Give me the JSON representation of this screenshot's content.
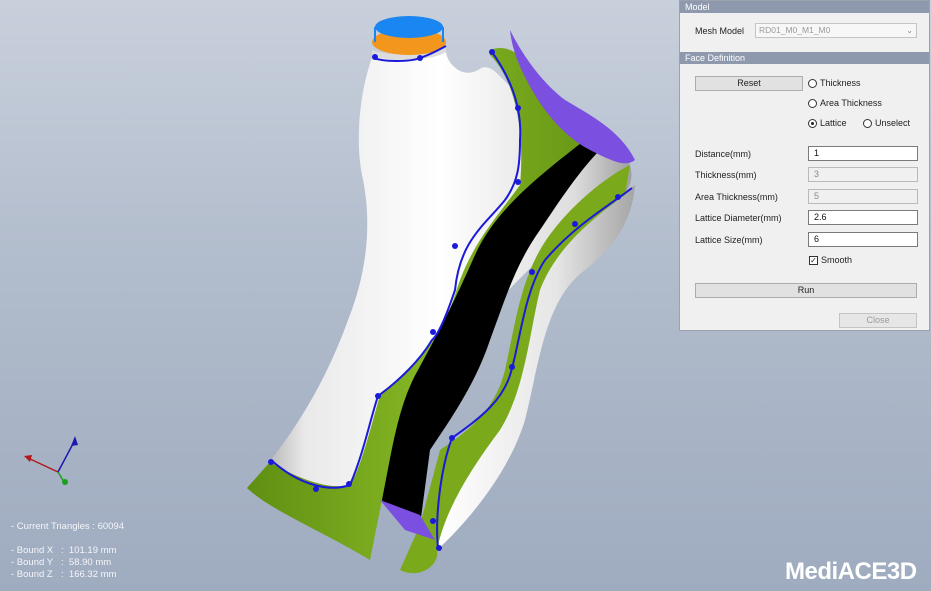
{
  "stats": {
    "triangles": "- Current Triangles : 60094",
    "bounds": [
      {
        "label": "- Bound X",
        "value": ":  101.19 mm"
      },
      {
        "label": "- Bound Y",
        "value": ":  58.90 mm"
      },
      {
        "label": "- Bound Z",
        "value": ":  166.32 mm"
      }
    ]
  },
  "logo": "MediACE3D",
  "panel": {
    "model_header": "Model",
    "mesh_model_label": "Mesh Model",
    "mesh_model_value": "RD01_M0_M1_M0",
    "face_header": "Face Definition",
    "reset_label": "Reset",
    "radios": [
      {
        "label": "Thickness",
        "checked": false
      },
      {
        "label": "Area Thickness",
        "checked": false
      },
      {
        "label": "Lattice",
        "checked": true
      },
      {
        "label": "Unselect",
        "checked": false
      }
    ],
    "fields": [
      {
        "label": "Distance(mm)",
        "value": "1",
        "disabled": false
      },
      {
        "label": "Thickness(mm)",
        "value": "3",
        "disabled": true
      },
      {
        "label": "Area Thickness(mm)",
        "value": "5",
        "disabled": true
      },
      {
        "label": "Lattice Diameter(mm)",
        "value": "2.6",
        "disabled": false
      },
      {
        "label": "Lattice Size(mm)",
        "value": "6",
        "disabled": false
      }
    ],
    "smooth_label": "Smooth",
    "smooth_checked": true,
    "run_label": "Run",
    "close_label": "Close"
  },
  "colors": {
    "lattice_green": "#7fae1f",
    "black_band": "#000000",
    "purple_rim": "#7b4fe0",
    "orange_rim": "#f2961c",
    "blue_cap": "#1a86f2",
    "curve_blue": "#1a1ad8"
  }
}
